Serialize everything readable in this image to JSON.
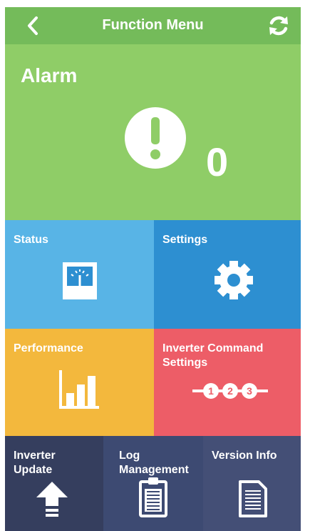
{
  "header": {
    "title": "Function Menu",
    "back_icon": "chevron-left-icon",
    "refresh_icon": "refresh-icon"
  },
  "alarm": {
    "title": "Alarm",
    "count": "0",
    "icon": "exclamation-icon"
  },
  "tiles": [
    {
      "label": "Status",
      "icon": "gauge-icon",
      "color": "#58b4e6"
    },
    {
      "label": "Settings",
      "icon": "gear-icon",
      "color": "#2d8fd1"
    },
    {
      "label": "Performance",
      "icon": "bar-chart-icon",
      "color": "#f3b83d"
    },
    {
      "label": "Inverter Command Settings",
      "icon": "numbered-steps-icon",
      "color": "#ed5d67",
      "steps": [
        "1",
        "2",
        "3"
      ]
    },
    {
      "label": "Inverter Update",
      "icon": "upload-arrow-icon",
      "color": "#353e5e"
    },
    {
      "label": "Log Management",
      "icon": "clipboard-icon",
      "color": "#3d4a72"
    },
    {
      "label": "Version Info",
      "icon": "document-icon",
      "color": "#444f76"
    }
  ],
  "colors": {
    "header": "#74bb5a",
    "alarm": "#8fcd67"
  }
}
